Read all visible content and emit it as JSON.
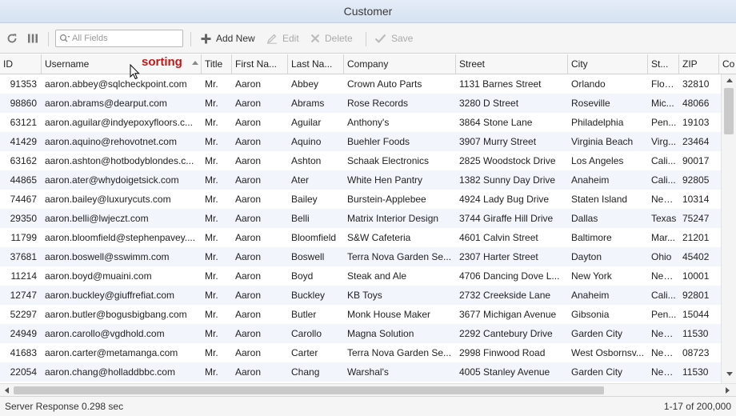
{
  "window": {
    "title": "Customer"
  },
  "toolbar": {
    "refresh_icon": "refresh-icon",
    "columns_icon": "columns-icon",
    "search_placeholder": "All Fields",
    "add_label": "Add New",
    "edit_label": "Edit",
    "delete_label": "Delete",
    "save_label": "Save"
  },
  "annotation": {
    "sorting_label": "sorting"
  },
  "columns": [
    "ID",
    "Username",
    "Title",
    "First Na...",
    "Last Na...",
    "Company",
    "Street",
    "City",
    "St...",
    "ZIP",
    "Co"
  ],
  "sort": {
    "column": "Username",
    "direction": "ascending"
  },
  "rows": [
    [
      "91353",
      "aaron.abbey@sqlcheckpoint.com",
      "Mr.",
      "Aaron",
      "Abbey",
      "Crown Auto Parts",
      "1131 Barnes Street",
      "Orlando",
      "Flori...",
      "32810"
    ],
    [
      "98860",
      "aaron.abrams@dearput.com",
      "Mr.",
      "Aaron",
      "Abrams",
      "Rose Records",
      "3280 D Street",
      "Roseville",
      "Mic...",
      "48066"
    ],
    [
      "63121",
      "aaron.aguilar@indyepoxyfloors.c...",
      "Mr.",
      "Aaron",
      "Aguilar",
      "Anthony's",
      "3864 Stone Lane",
      "Philadelphia",
      "Pen...",
      "19103"
    ],
    [
      "41429",
      "aaron.aquino@rehovotnet.com",
      "Mr.",
      "Aaron",
      "Aquino",
      "Buehler Foods",
      "3907 Murry Street",
      "Virginia Beach",
      "Virg...",
      "23464"
    ],
    [
      "63162",
      "aaron.ashton@hotbodyblondes.c...",
      "Mr.",
      "Aaron",
      "Ashton",
      "Schaak Electronics",
      "2825 Woodstock Drive",
      "Los Angeles",
      "Cali...",
      "90017"
    ],
    [
      "44865",
      "aaron.ater@whydoigetsick.com",
      "Mr.",
      "Aaron",
      "Ater",
      "White Hen Pantry",
      "1382 Sunny Day Drive",
      "Anaheim",
      "Cali...",
      "92805"
    ],
    [
      "74467",
      "aaron.bailey@luxurycuts.com",
      "Mr.",
      "Aaron",
      "Bailey",
      "Burstein-Applebee",
      "4924 Lady Bug Drive",
      "Staten Island",
      "New...",
      "10314"
    ],
    [
      "29350",
      "aaron.belli@lwjeczt.com",
      "Mr.",
      "Aaron",
      "Belli",
      "Matrix Interior Design",
      "3744 Giraffe Hill Drive",
      "Dallas",
      "Texas",
      "75247"
    ],
    [
      "11799",
      "aaron.bloomfield@stephenpavey....",
      "Mr.",
      "Aaron",
      "Bloomfield",
      "S&W Cafeteria",
      "4601 Calvin Street",
      "Baltimore",
      "Mar...",
      "21201"
    ],
    [
      "37681",
      "aaron.boswell@sswimm.com",
      "Mr.",
      "Aaron",
      "Boswell",
      "Terra Nova Garden Se...",
      "2307 Harter Street",
      "Dayton",
      "Ohio",
      "45402"
    ],
    [
      "11214",
      "aaron.boyd@muaini.com",
      "Mr.",
      "Aaron",
      "Boyd",
      "Steak and Ale",
      "4706 Dancing Dove L...",
      "New York",
      "New...",
      "10001"
    ],
    [
      "12747",
      "aaron.buckley@giuffrefiat.com",
      "Mr.",
      "Aaron",
      "Buckley",
      "KB Toys",
      "2732 Creekside Lane",
      "Anaheim",
      "Cali...",
      "92801"
    ],
    [
      "52297",
      "aaron.butler@bogusbigbang.com",
      "Mr.",
      "Aaron",
      "Butler",
      "Monk House Maker",
      "3677 Michigan Avenue",
      "Gibsonia",
      "Pen...",
      "15044"
    ],
    [
      "24949",
      "aaron.carollo@vgdhold.com",
      "Mr.",
      "Aaron",
      "Carollo",
      "Magna Solution",
      "2292 Cantebury Drive",
      "Garden City",
      "New...",
      "11530"
    ],
    [
      "41683",
      "aaron.carter@metamanga.com",
      "Mr.",
      "Aaron",
      "Carter",
      "Terra Nova Garden Se...",
      "2998 Finwood Road",
      "West Osbornsv...",
      "New...",
      "08723"
    ],
    [
      "22054",
      "aaron.chang@holladdbbc.com",
      "Mr.",
      "Aaron",
      "Chang",
      "Warshal's",
      "4005 Stanley Avenue",
      "Garden City",
      "New...",
      "11530"
    ]
  ],
  "status": {
    "response": "Server Response 0.298 sec",
    "paging": "1-17 of 200,000"
  }
}
